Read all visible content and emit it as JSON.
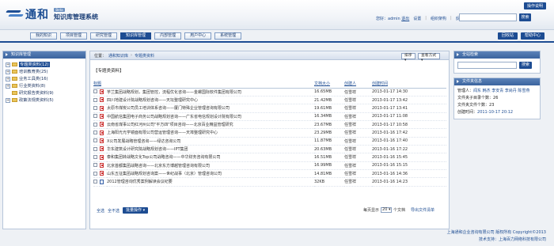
{
  "header": {
    "logo_text": "通和",
    "beta": "Beta",
    "system_title": "知识库管理系统",
    "help": "操作说明",
    "greeting": "您好：admin",
    "exit": "退出",
    "links": [
      "设置",
      "组织架构",
      "反馈"
    ],
    "search_placeholder": "",
    "search_button": "搜索"
  },
  "nav": {
    "tabs": [
      "我的知识",
      "项目管理",
      "研究管理",
      "知识库管理",
      "内部管理",
      "用户中心",
      "系统管理"
    ],
    "active_index": 3,
    "right_buttons": [
      "回收站",
      "帮助中心"
    ]
  },
  "left": {
    "title": "知识库管理",
    "tree": [
      {
        "label": "专题类资料(12)",
        "expander": "+",
        "selected": true
      },
      {
        "label": "培训教育类(25)",
        "expander": "+",
        "selected": false
      },
      {
        "label": "业务工具类(16)",
        "expander": "+",
        "selected": false
      },
      {
        "label": "行业类资料(8)",
        "expander": "+",
        "selected": false
      },
      {
        "label": "研究报告类资料(9)",
        "expander": "",
        "selected": false
      },
      {
        "label": "政策法规类资料(5)",
        "expander": "+",
        "selected": false
      }
    ]
  },
  "main": {
    "breadcrumb": [
      "位置：",
      "通和知识库",
      "专题类资料"
    ],
    "order_button": "排序",
    "view_button": "查看方式",
    "folder_title": "【专题类资料】",
    "columns": [
      "标题",
      "文档大小",
      "创建人",
      "创建时间"
    ],
    "rows": [
      {
        "name": "芋兰集团战略规划，集团管控，流程优化咨询——金螺国际软件集团有限公司",
        "size": "16.65MB",
        "creator": "任雪祥",
        "date": "2013-01-17 14:30",
        "icon": "pdf"
      },
      {
        "name": "四川地建设计院战略规划咨询——天坛整理研究中心",
        "size": "21.42MB",
        "creator": "任雪祥",
        "date": "2013-01-17 13:42",
        "icon": "pdf"
      },
      {
        "name": "太原市煤炭公司员工培训体系咨询——厦门特殊企业管理咨询有限公司",
        "size": "19.61MB",
        "creator": "任雪祥",
        "date": "2013-01-17 13:41",
        "icon": "pdf"
      },
      {
        "name": "中国航信集团电子商务公司战略规划咨询——广东省电信规划设计院有限公司",
        "size": "16.34MB",
        "creator": "任雪祥",
        "date": "2013-01-17 11:08",
        "icon": "pdf"
      },
      {
        "name": "云南省煤事公司红河州公司\"平方四\"项目咨询——北京百业精益管理研究",
        "size": "23.67MB",
        "creator": "任雪祥",
        "date": "2013-01-17 10:58",
        "icon": "pdf"
      },
      {
        "name": "上海阳光光学镜面有限公司营运管理咨询——天埠整理研究中心",
        "size": "23.29MB",
        "creator": "任雪祥",
        "date": "2013-01-16 17:42",
        "icon": "pdf"
      },
      {
        "name": "X公司发展战略管理咨询——绿达咨询公司",
        "size": "11.87MB",
        "creator": "任雪祥",
        "date": "2013-01-16 17:40",
        "icon": "pdf"
      },
      {
        "name": "华东建筑设计研究院战略规划咨询——IPT集团",
        "size": "20.63MB",
        "creator": "任雪祥",
        "date": "2013-01-16 17:22",
        "icon": "pdf"
      },
      {
        "name": "泰和集团转战略文化Top公司战略咨询——中华财务咨询有限公司",
        "size": "16.51MB",
        "creator": "任雪祥",
        "date": "2013-01-16 15:45",
        "icon": "pdf"
      },
      {
        "name": "北京首都集团战略咨询——北京东方博越管理咨询有限公司",
        "size": "16.99MB",
        "creator": "任雪祥",
        "date": "2013-01-16 15:15",
        "icon": "pdf"
      },
      {
        "name": "山东五征集团战略规划咨询案——世纪战事（北京）管理咨询公司",
        "size": "14.81MB",
        "creator": "任雪祥",
        "date": "2013-01-16 14:36",
        "icon": "pdf"
      },
      {
        "name": "2012管理咨询优秀案例解读会议纪要",
        "size": "32KB",
        "creator": "任雪祥",
        "date": "2013-01-16 14:23",
        "icon": "doc"
      }
    ],
    "footer": {
      "select_all": "全选",
      "deselect": "全不选",
      "op_button": "批量操作",
      "per_page_label": "每页显示",
      "per_page_value": "20",
      "per_page_unit": "个文档",
      "export": "导出文件清单"
    }
  },
  "right": {
    "search_title": "全站检索",
    "search_button": "搜索",
    "info_title": "文件夹信息",
    "managers_label": "管理人：",
    "managers": "闻东 韩杰 李安青 李尚丹 陈雪燕",
    "subfolders_label": "文件夹子目录个数：",
    "subfolders": "26",
    "filecount_label": "文件夹文件个数：",
    "filecount": "23",
    "created_label": "创建时间：",
    "created": "2011-10-17 20:12"
  },
  "footer": {
    "line1": "上海通和企业咨询有限公司 版权所有 Copyright©2013",
    "line2": "技术支持：上海百力网络科技有限公司"
  },
  "colors": {
    "primary": "#1d4c92",
    "panel_head": "#3a639e",
    "background": "#eef1f5"
  }
}
